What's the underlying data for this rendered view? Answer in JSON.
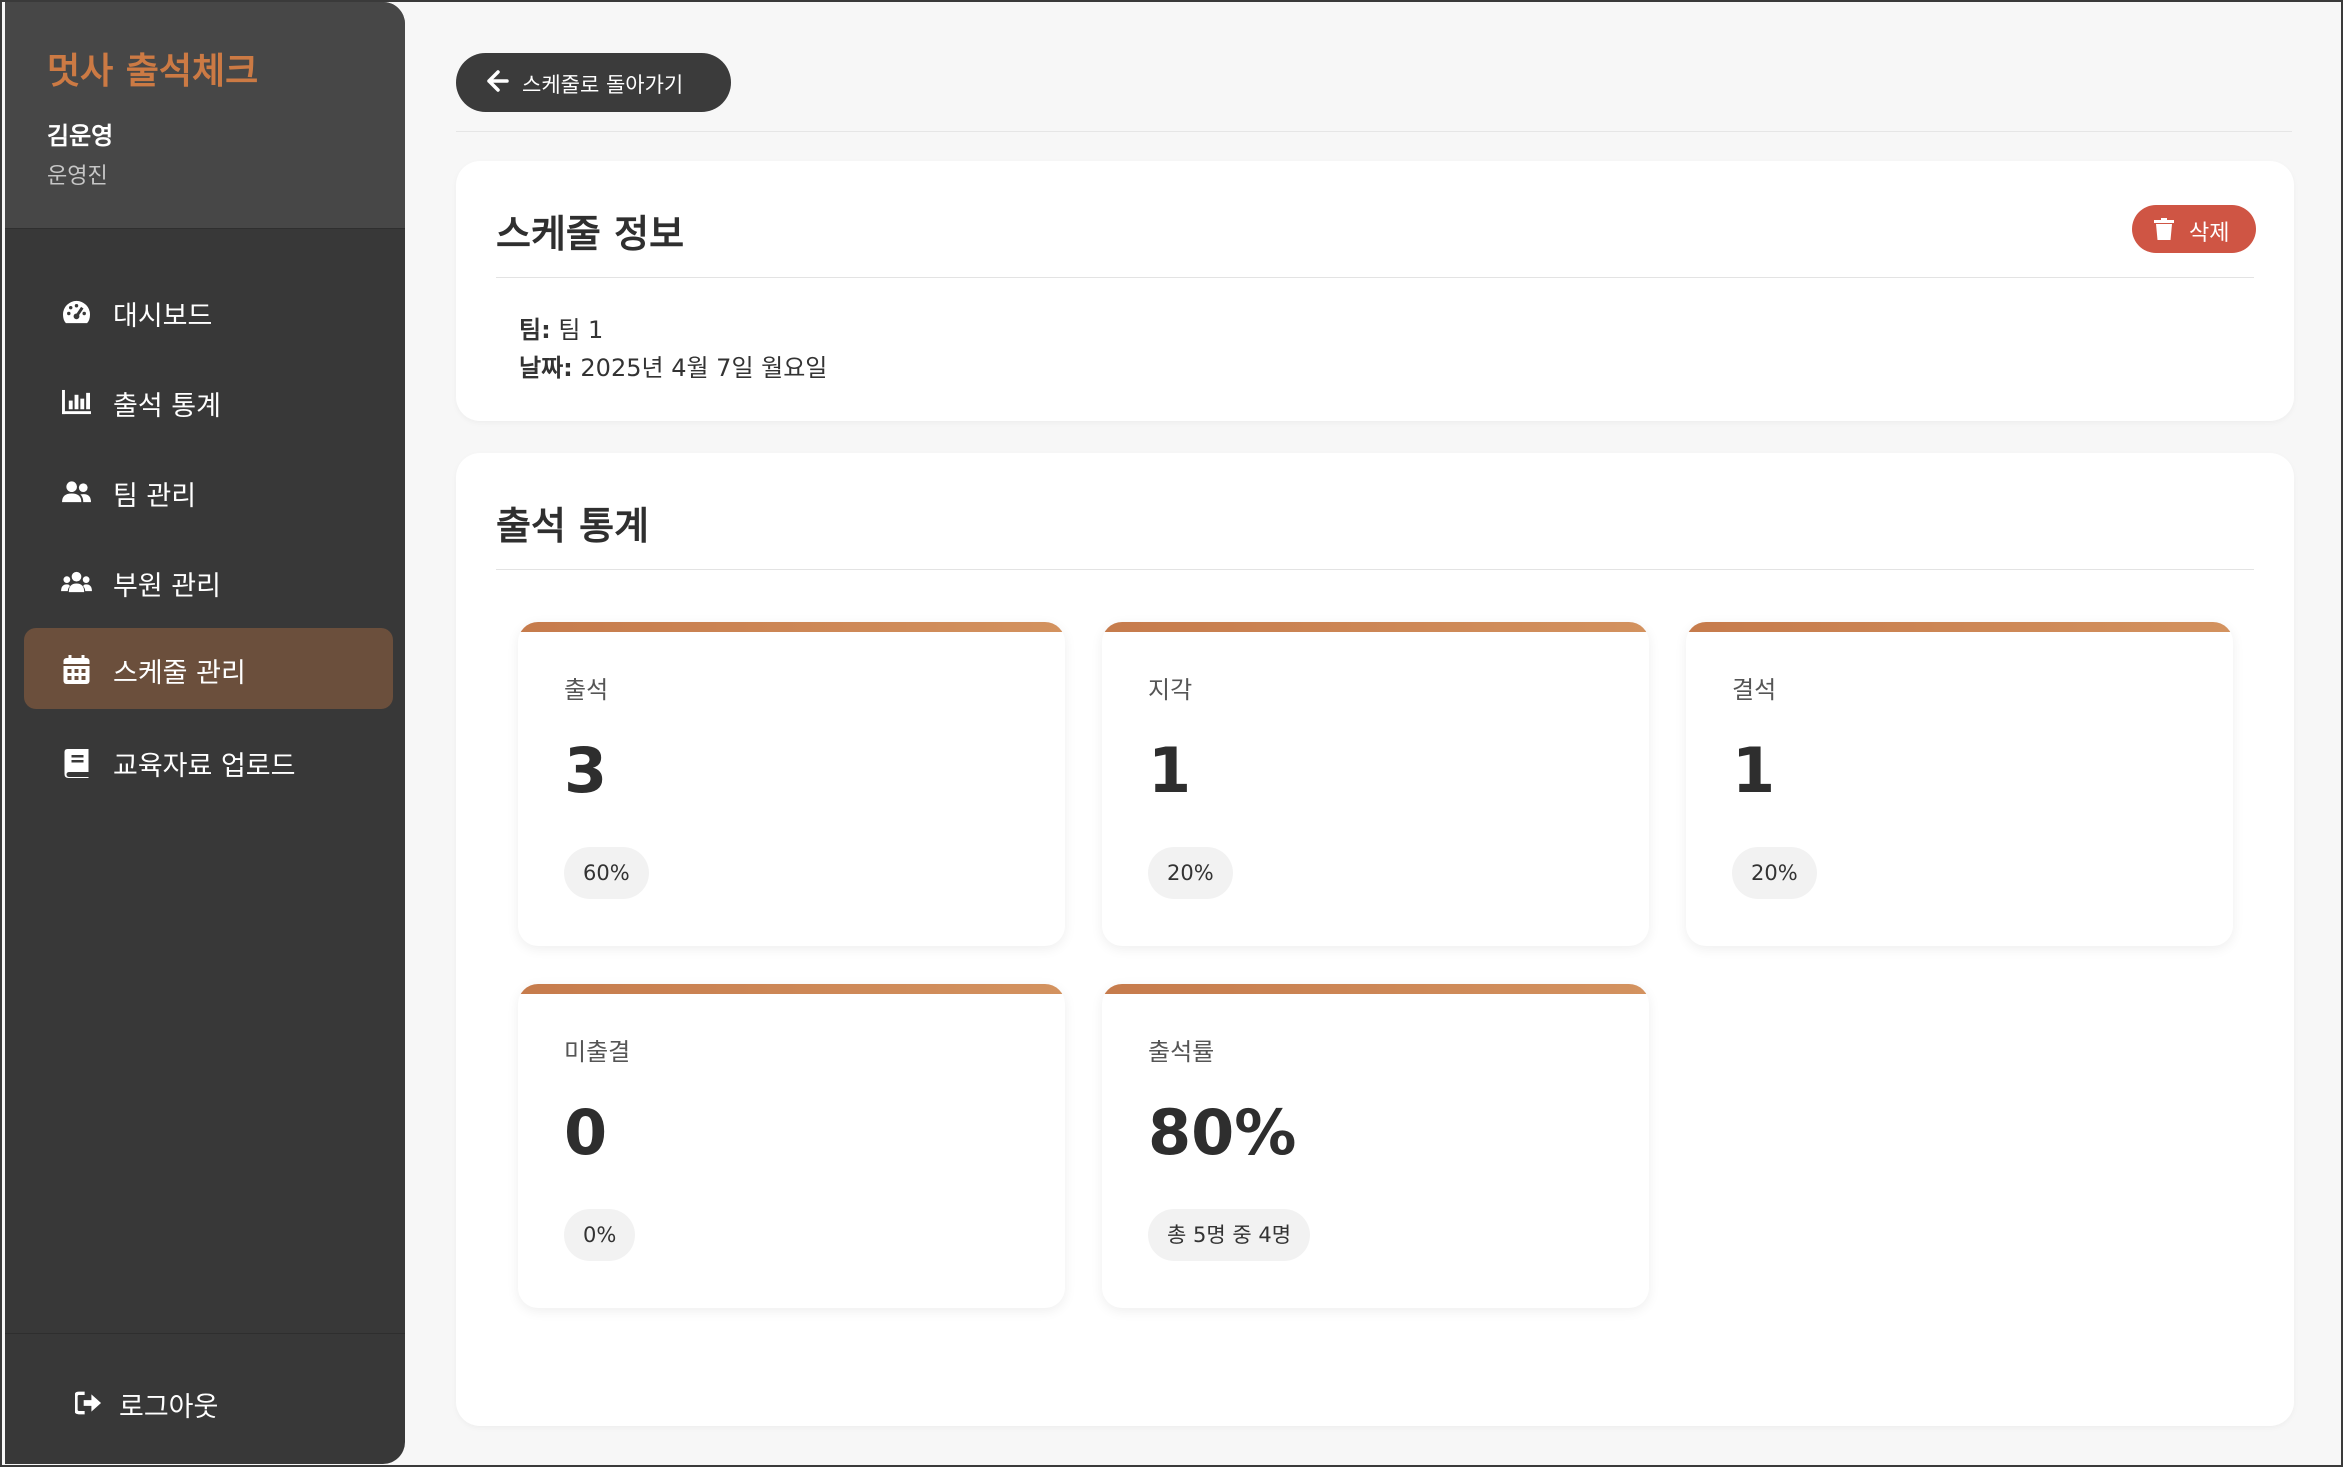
{
  "sidebar": {
    "brand": "멋사 출석체크",
    "user_name": "김운영",
    "user_role": "운영진",
    "items": [
      {
        "label": "대시보드",
        "icon": "dashboard-gauge-icon"
      },
      {
        "label": "출석 통계",
        "icon": "bar-chart-icon"
      },
      {
        "label": "팀 관리",
        "icon": "user-group-icon"
      },
      {
        "label": "부원 관리",
        "icon": "users-icon"
      },
      {
        "label": "스케줄 관리",
        "icon": "calendar-icon",
        "active": true
      },
      {
        "label": "교육자료 업로드",
        "icon": "book-icon"
      }
    ],
    "logout_label": "로그아웃"
  },
  "header": {
    "back_label": "스케줄로 돌아가기"
  },
  "schedule_info": {
    "title": "스케줄 정보",
    "delete_label": "삭제",
    "team_label": "팀:",
    "team_value": "팀 1",
    "date_label": "날짜:",
    "date_value": "2025년 4월 7일 월요일"
  },
  "stats": {
    "title": "출석 통계",
    "cards": [
      {
        "label": "출석",
        "value": "3",
        "badge": "60%"
      },
      {
        "label": "지각",
        "value": "1",
        "badge": "20%"
      },
      {
        "label": "결석",
        "value": "1",
        "badge": "20%"
      },
      {
        "label": "미출결",
        "value": "0",
        "badge": "0%"
      },
      {
        "label": "출석률",
        "value": "80%",
        "badge": "총 5명 중 4명"
      }
    ]
  },
  "colors": {
    "accent": "#cc7a44",
    "sidebar_bg": "#383838",
    "active_nav": "#6b4f3c",
    "delete": "#cf5544"
  }
}
